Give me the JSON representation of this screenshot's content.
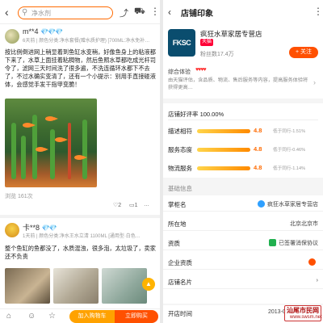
{
  "left": {
    "header": {
      "back_icon": "back-arrow-icon",
      "search_placeholder": "净水剂",
      "share_icon": "share-icon",
      "cart_icon": "cart-icon",
      "more_icon": "more-vertical-icon"
    },
    "review1": {
      "user": "m**4",
      "badge": "💎💎💎",
      "meta": "6天前 | 颜色分类:净水套餐(赠水质护理) [700ML:净水免补…",
      "text": "按比例倒进网上稍显着到鱼缸水变稍，好像鱼身上的粘液都下来了，水草上面挂着粘稠物，然后鱼照水草都吃成光杆司令了，滤网三天时间洗了很多遍，不洗连循环水都下不去了，不过水确实变清了，还有一个小提示：别用手直接碰液体，会感觉手发干指甲变脆！",
      "views": "浏览 161次",
      "likes": "2",
      "comments": "1",
      "collect": "…"
    },
    "review2": {
      "user": "卡**8",
      "badge": "💎💎",
      "meta": "1天前 | 颜色分类:净水王水立清 1100ML [通用型·白色…",
      "text": "整个鱼缸的鱼都没了，水质混浊，很多泡，太垃圾了，卖家还不负责"
    },
    "bottom": {
      "shop_icon": "shop-icon",
      "service_icon": "service-icon",
      "fav_icon": "star-icon",
      "add_cart": "加入购物车",
      "buy_now": "立即购买"
    }
  },
  "right": {
    "header": {
      "back_icon": "back-arrow-icon",
      "title": "店铺印象",
      "more_icon": "more-vertical-icon"
    },
    "shop": {
      "logo_text": "FKSC",
      "name": "疯狂水草家居专营店",
      "tmall": "天猫",
      "fans": "粉丝数17.4万",
      "follow": "+ 关注"
    },
    "rating": {
      "label": "综合体验",
      "hearts": "♥♥♥♥",
      "desc": "由天猫评估，含品质、物流、售后服务等内容，提高服务体验将获得更高…",
      "chev": "›"
    },
    "scores": {
      "good_rate": "店铺好评率 100.00%",
      "rows": [
        {
          "label": "描述相符",
          "score": "4.8",
          "compare": "低于同行-1.51%",
          "fill": 0.76
        },
        {
          "label": "服务态度",
          "score": "4.8",
          "compare": "低于同行-0.46%",
          "fill": 0.76
        },
        {
          "label": "物流服务",
          "score": "4.8",
          "compare": "低于同行-1.14%",
          "fill": 0.76
        }
      ]
    },
    "basic": {
      "title": "基础信息",
      "rows": [
        {
          "k": "掌柜名",
          "v": "疯狂水草家居专营店",
          "icon": "chat-icon",
          "color": "#2fa0ff"
        },
        {
          "k": "所在地",
          "v": "北京北京市",
          "icon": "",
          "color": ""
        },
        {
          "k": "资质",
          "v": "已签署消保协议",
          "icon": "shield-icon",
          "color": "#21b04f"
        },
        {
          "k": "企业资质",
          "v": "",
          "icon": "arrow-circle-icon",
          "color": "#ff5000"
        },
        {
          "k": "店铺名片",
          "v": "›",
          "icon": "",
          "color": ""
        }
      ],
      "open_time_k": "开店时间",
      "open_time_v": "2013-05-15 14:18:32"
    }
  },
  "watermark": {
    "text": "汕尾市民网",
    "url": "www.swsm.net"
  }
}
